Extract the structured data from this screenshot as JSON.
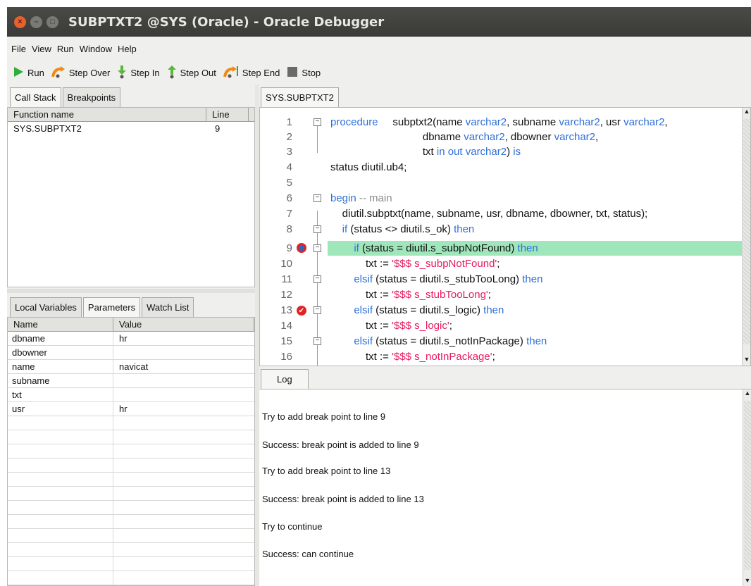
{
  "window": {
    "title": "SUBPTXT2 @SYS (Oracle) - Oracle Debugger",
    "close_glyph": "×",
    "min_glyph": "–",
    "max_glyph": "□"
  },
  "menu": [
    "File",
    "View",
    "Run",
    "Window",
    "Help"
  ],
  "toolbar": {
    "run": "Run",
    "step_over": "Step Over",
    "step_in": "Step In",
    "step_out": "Step Out",
    "step_end": "Step End",
    "stop": "Stop"
  },
  "left_tabs": {
    "call_stack": "Call Stack",
    "breakpoints": "Breakpoints"
  },
  "call_stack": {
    "headers": [
      "Function name",
      "Line"
    ],
    "rows": [
      [
        "SYS.SUBPTXT2",
        "9"
      ]
    ]
  },
  "var_tabs": {
    "local": "Local Variables",
    "parameters": "Parameters",
    "watch": "Watch List"
  },
  "parameters": {
    "headers": [
      "Name",
      "Value"
    ],
    "rows": [
      [
        "dbname",
        "hr"
      ],
      [
        "dbowner",
        ""
      ],
      [
        "name",
        "navicat"
      ],
      [
        "subname",
        ""
      ],
      [
        "txt",
        ""
      ],
      [
        "usr",
        "hr"
      ]
    ]
  },
  "editor_tab": "SYS.SUBPTXT2",
  "code": {
    "line_numbers": [
      "1",
      "2",
      "3",
      "4",
      "5",
      "6",
      "7",
      "8",
      "9",
      "10",
      "11",
      "12",
      "13",
      "14",
      "15",
      "16"
    ],
    "l1_a": "procedure",
    "l1_b": "     subptxt2(name ",
    "l1_c": "varchar2",
    "l1_d": ", subname ",
    "l1_e": "varchar2",
    "l1_f": ", usr ",
    "l1_g": "varchar2",
    "l1_h": ",",
    "l2_a": "                 dbname ",
    "l2_b": "varchar2",
    "l2_c": ", dbowner ",
    "l2_d": "varchar2",
    "l2_e": ",",
    "l3_a": "                 txt ",
    "l3_b": "in out varchar2",
    "l3_c": ") ",
    "l3_d": "is",
    "l4": "status diutil.ub4;",
    "l6_a": "begin",
    "l6_b": " -- main",
    "l7": "    diutil.subptxt(name, subname, usr, dbname, dbowner, txt, status);",
    "l8_a": "    if",
    "l8_b": " (status <> diutil.s_ok) ",
    "l8_c": "then",
    "l9_a": "        if",
    "l9_b": " (status = diutil.s_subpNotFound) ",
    "l9_c": "then",
    "l10_a": "            txt := ",
    "l10_b": "'$$$ s_subpNotFound'",
    "l10_c": ";",
    "l11_a": "        elsif",
    "l11_b": " (status = diutil.s_stubTooLong) ",
    "l11_c": "then",
    "l12_a": "            txt := ",
    "l12_b": "'$$$ s_stubTooLong'",
    "l12_c": ";",
    "l13_a": "        elsif",
    "l13_b": " (status = diutil.s_logic) ",
    "l13_c": "then",
    "l14_a": "            txt := ",
    "l14_b": "'$$$ s_logic'",
    "l14_c": ";",
    "l15_a": "        elsif",
    "l15_b": " (status = diutil.s_notInPackage) ",
    "l15_c": "then",
    "l16_a": "            txt := ",
    "l16_b": "'$$$ s_notInPackage'",
    "l16_c": ";"
  },
  "log_tab": "Log",
  "log": [
    "Try to add break point to line 9",
    "Success: break point is added to line 9",
    "Try to add break point to line 13",
    "Success: break point is added to line 13",
    "Try to continue",
    "Success: can continue"
  ],
  "colors": {
    "keyword": "#2e6fd8",
    "string": "#e8185f",
    "current_line": "#9fe6bb",
    "breakpoint": "#e02424"
  },
  "icons": {
    "run": "play-triangle-icon",
    "step_over": "step-over-arrow-icon",
    "step_in": "step-in-arrow-icon",
    "step_out": "step-out-arrow-icon",
    "step_end": "step-end-arrow-icon",
    "stop": "stop-square-icon"
  }
}
